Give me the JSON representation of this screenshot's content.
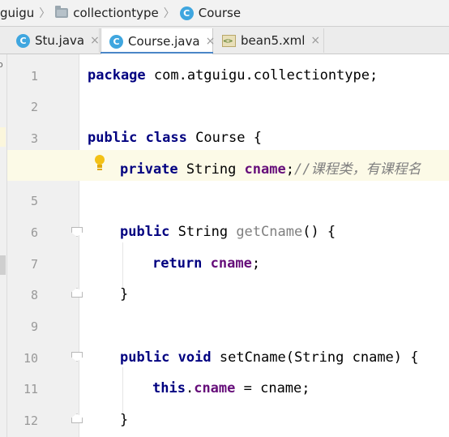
{
  "breadcrumb": {
    "items": [
      "guigu",
      "collectiontype",
      "Course"
    ]
  },
  "tabs": [
    {
      "label": "Stu.java",
      "icon": "class-icon",
      "active": false
    },
    {
      "label": "Course.java",
      "icon": "class-icon",
      "active": true
    },
    {
      "label": "bean5.xml",
      "icon": "xml-file-icon",
      "active": false
    }
  ],
  "icons": {
    "class_letter": "C",
    "close_glyph": "×",
    "outer_glyph": "o"
  },
  "colors": {
    "keyword": "#000080",
    "field": "#660e7a",
    "comment": "#808080",
    "accent": "#3fa6df"
  },
  "editor": {
    "line_numbers": [
      "1",
      "2",
      "3",
      "4",
      "5",
      "6",
      "7",
      "8",
      "9",
      "10",
      "11",
      "12"
    ],
    "lines": {
      "l1_kw": "package",
      "l1_rest": " com.atguigu.collectiontype;",
      "l3_kw1": "public",
      "l3_kw2": "class",
      "l3_rest": " Course {",
      "l4_kw": "private",
      "l4_type": " String ",
      "l4_field": "cname",
      "l4_semi": ";",
      "l4_comment": "//课程类，有课程名",
      "l6_kw": "public",
      "l6_type": " String ",
      "l6_method": "getCname",
      "l6_rest": "() {",
      "l7_kw": "return",
      "l7_field": "cname",
      "l7_semi": ";",
      "l8": "}",
      "l10_kw1": "public",
      "l10_kw2": "void",
      "l10_rest": " setCname(String cname) {",
      "l11_kw": "this",
      "l11_dot": ".",
      "l11_field": "cname",
      "l11_rest": " = cname;",
      "l12": "}"
    }
  }
}
